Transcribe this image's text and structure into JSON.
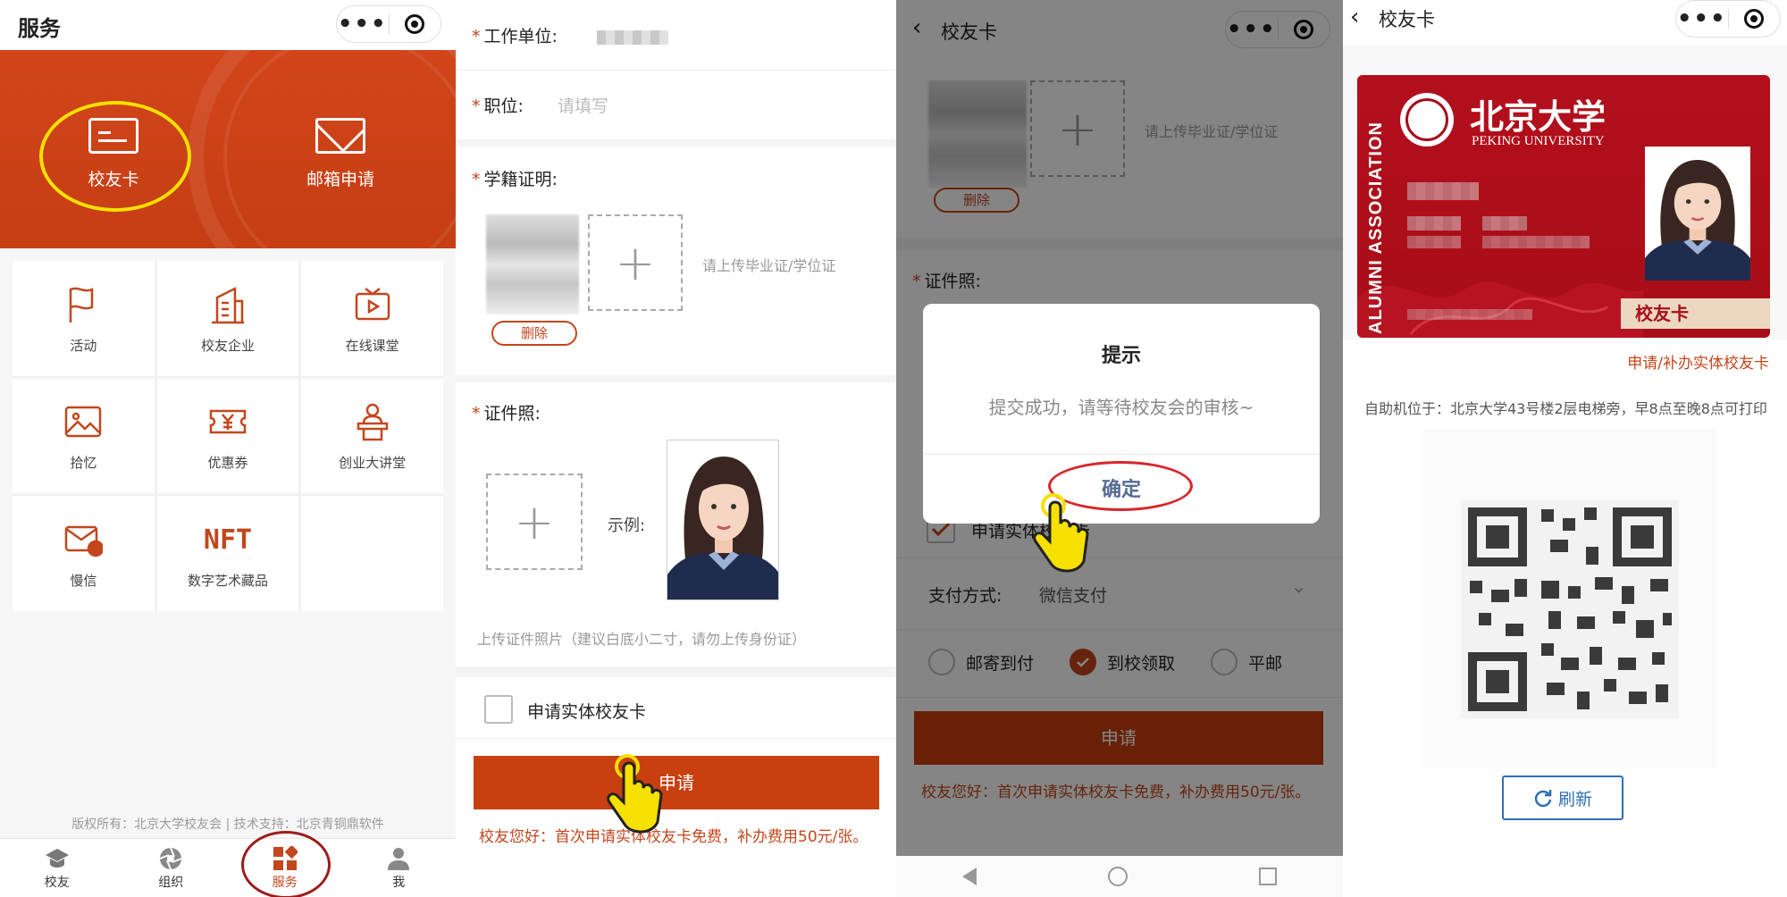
{
  "colors": {
    "brand": "#c3461c",
    "dialog_ok": "#576b95",
    "refresh": "#2e6fb5"
  },
  "panel1": {
    "title": "服务",
    "banner": [
      {
        "label": "校友卡",
        "icon": "card-icon"
      },
      {
        "label": "邮箱申请",
        "icon": "mail-icon"
      }
    ],
    "grid": [
      {
        "label": "活动",
        "icon": "flag-icon"
      },
      {
        "label": "校友企业",
        "icon": "building-icon"
      },
      {
        "label": "在线课堂",
        "icon": "tv-icon"
      },
      {
        "label": "拾忆",
        "icon": "image-icon"
      },
      {
        "label": "优惠券",
        "icon": "coupon-icon"
      },
      {
        "label": "创业大讲堂",
        "icon": "lecture-icon"
      },
      {
        "label": "慢信",
        "icon": "slow-mail-icon"
      },
      {
        "label": "数字艺术藏品",
        "icon": "nft-icon",
        "icon_text": "NFT"
      }
    ],
    "copyright": "版权所有：北京大学校友会  |  技术支持：北京青铜鼎软件",
    "tabs": [
      {
        "label": "校友",
        "icon": "graduation-cap-icon"
      },
      {
        "label": "组织",
        "icon": "aperture-icon"
      },
      {
        "label": "服务",
        "icon": "apps-icon",
        "active": true
      },
      {
        "label": "我",
        "icon": "user-icon"
      }
    ]
  },
  "panel2": {
    "work_unit_label": "工作单位:",
    "position_label": "职位:",
    "position_placeholder": "请填写",
    "enrollment_label": "学籍证明:",
    "upload_hint": "请上传毕业证/学位证",
    "delete_label": "删除",
    "id_photo_label": "证件照:",
    "example_label": "示例:",
    "photo_hint": "上传证件照片（建议白底小二寸，请勿上传身份证）",
    "physical_card_label": "申请实体校友卡",
    "apply_label": "申请",
    "notice": "校友您好：首次申请实体校友卡免费，补办费用50元/张。"
  },
  "panel3": {
    "title": "校友卡",
    "upload_hint": "请上传毕业证/学位证",
    "delete_label": "删除",
    "id_photo_label": "证件照:",
    "physical_card_label": "申请实体校友卡",
    "payment_label": "支付方式:",
    "payment_value": "微信支付",
    "delivery_options": [
      {
        "label": "邮寄到付",
        "checked": false
      },
      {
        "label": "到校领取",
        "checked": true
      },
      {
        "label": "平邮",
        "checked": false
      }
    ],
    "apply_label": "申请",
    "notice": "校友您好：首次申请实体校友卡免费，补办费用50元/张。",
    "dialog": {
      "title": "提示",
      "message": "提交成功，请等待校友会的审核~",
      "ok_label": "确定"
    }
  },
  "panel4": {
    "title": "校友卡",
    "card": {
      "university_cn": "北京大学",
      "university_en": "PEKING UNIVERSITY",
      "side_text": "ALUMNI ASSOCIATION",
      "badge": "校友卡"
    },
    "apply_link": "申请/补办实体校友卡",
    "kiosk_info": "自助机位于：北京大学43号楼2层电梯旁，早8点至晚8点可打印",
    "refresh_label": "刷新"
  }
}
